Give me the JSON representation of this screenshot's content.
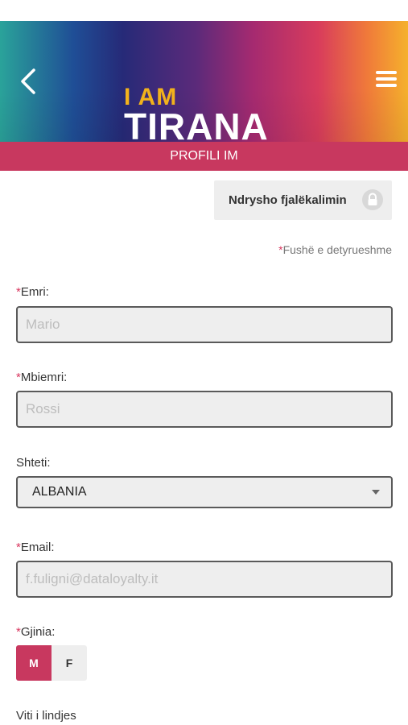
{
  "header": {
    "logo_top": "I AM",
    "logo_bottom": "TIRANA",
    "back_icon": "chevron-left-icon",
    "menu_icon": "hamburger-menu-icon"
  },
  "page_title": "PROFILI IM",
  "change_password": {
    "label": "Ndrysho fjalëkalimin",
    "icon": "lock-icon"
  },
  "required_note": {
    "star": "*",
    "text": "Fushë e detyrueshme"
  },
  "form": {
    "first_name": {
      "star": "*",
      "label": "Emri:",
      "placeholder": "Mario"
    },
    "last_name": {
      "star": "*",
      "label": "Mbiemri:",
      "placeholder": "Rossi"
    },
    "country": {
      "label": "Shteti:",
      "value": "ALBANIA"
    },
    "email": {
      "star": "*",
      "label": "Email:",
      "placeholder": "f.fuligni@dataloyalty.it"
    },
    "gender": {
      "star": "*",
      "label": "Gjinia:",
      "option_m": "M",
      "option_f": "F",
      "selected": "M"
    },
    "birth_year": {
      "label": "Viti i lindjes"
    }
  },
  "colors": {
    "accent": "#c8385f",
    "logo_yellow": "#f2b21c"
  }
}
